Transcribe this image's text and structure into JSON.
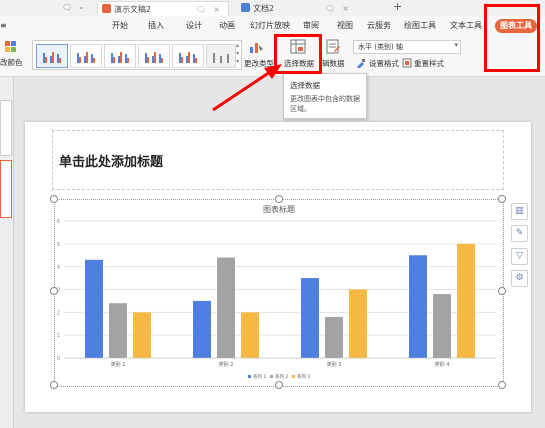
{
  "titlebar": {
    "tabs": [
      {
        "label": "演示文稿2",
        "active": true
      },
      {
        "label": "文档2",
        "active": false
      }
    ],
    "new_tab": "+"
  },
  "menubar": {
    "items": [
      "开始",
      "插入",
      "设计",
      "动画",
      "幻灯片放映",
      "审阅",
      "视图",
      "云服务",
      "绘图工具",
      "文本工具"
    ],
    "chart_tools": "图表工具"
  },
  "ribbon": {
    "change_color": "改颜色",
    "change_type": "更改类型",
    "select_data": "选择数据",
    "edit_data": "辑数据",
    "axis_select": "水平 (类别) 轴",
    "set_format": "设置格式",
    "reset_style": "重置样式"
  },
  "tooltip": {
    "title": "选择数据",
    "description": "更改图表中包含的数据区域。"
  },
  "slide": {
    "title_placeholder": "单击此处添加标题"
  },
  "colors": {
    "series1": "#4f7fe0",
    "series2": "#a3a3a3",
    "series3": "#f5b843",
    "highlight": "#ff0000",
    "chart_tools_tab": "#e8663d"
  },
  "chart_data": {
    "type": "bar",
    "title": "图表标题",
    "categories": [
      "类别 1",
      "类别 2",
      "类别 3",
      "类别 4"
    ],
    "series": [
      {
        "name": "系列 1",
        "values": [
          4.3,
          2.5,
          3.5,
          4.5
        ]
      },
      {
        "name": "系列 2",
        "values": [
          2.4,
          4.4,
          1.8,
          2.8
        ]
      },
      {
        "name": "系列 3",
        "values": [
          2,
          2,
          3,
          5
        ]
      }
    ],
    "y_ticks": [
      "0",
      "1",
      "2",
      "3",
      "4",
      "5",
      "6"
    ],
    "ylim": [
      0,
      6
    ],
    "grid": true,
    "legend_position": "bottom"
  }
}
